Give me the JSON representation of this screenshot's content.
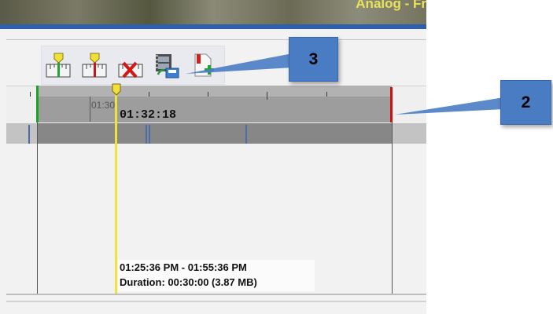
{
  "video": {
    "overlay_text": "Analog - Fr"
  },
  "toolbar": {
    "buttons": [
      {
        "name": "set-start-marker-button",
        "icon": "start-marker-ruler-icon"
      },
      {
        "name": "set-end-marker-button",
        "icon": "end-marker-ruler-icon"
      },
      {
        "name": "clear-markers-button",
        "icon": "clear-markers-ruler-icon"
      },
      {
        "name": "export-video-button",
        "icon": "film-export-icon"
      },
      {
        "name": "add-bookmark-button",
        "icon": "bookmark-add-icon"
      }
    ]
  },
  "timeline": {
    "ruler_label": "01:30",
    "current_time": "01:32:18",
    "selection_range": "01:25:36 PM - 01:55:36 PM",
    "selection_duration": "Duration: 00:30:00 (3.87 MB)"
  },
  "callouts": {
    "toolbar_callout": "3",
    "end_marker_callout": "2"
  },
  "colors": {
    "start_marker": "#18a326",
    "end_marker": "#d01010",
    "playhead": "#efe23a",
    "callout": "#4a7cc4",
    "header_blue": "#2d5fb0"
  }
}
